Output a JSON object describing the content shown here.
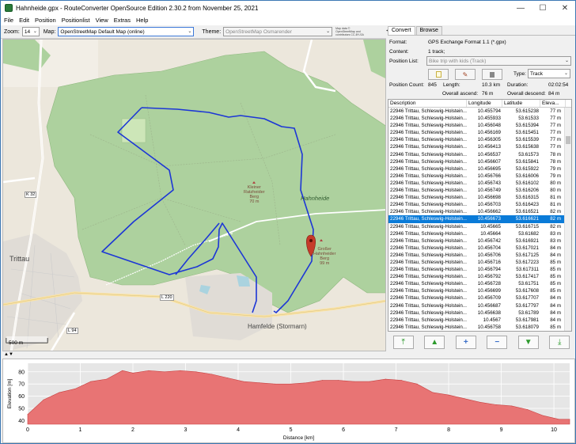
{
  "window": {
    "title": "Hahnheide.gpx - RouteConverter OpenSource Edition 2.30.2 from November 25, 2021",
    "minimize": "—",
    "maximize": "☐",
    "close": "✕"
  },
  "menu": [
    "File",
    "Edit",
    "Position",
    "Positionlist",
    "View",
    "Extras",
    "Help"
  ],
  "toolbar": {
    "zoom_label": "Zoom:",
    "zoom_value": "14",
    "map_label": "Map:",
    "map_value": "OpenStreetMap Default Map (online)",
    "theme_label": "Theme:",
    "theme_value": "OpenStreetMap Osmarender",
    "attribution": "Map data © OpenStreetMap and contributors CC-BY-SA"
  },
  "map": {
    "labels": {
      "hahnheide": "Hahnheide",
      "kleiner": "Kleiner",
      "kleiner2": "Ratzheider",
      "kleiner3": "Berg",
      "kleiner4": "70 m",
      "grosser": "Großer",
      "grosser2": "Hahnheider",
      "grosser3": "Berg",
      "grosser4": "99 m",
      "trittau": "Trittau",
      "hamfelde": "Hamfelde (Stormarn)",
      "k32": "K 32",
      "l94": "L 94",
      "l220": "L 220",
      "scale": "500 m"
    }
  },
  "right_panel": {
    "tabs": [
      "Convert",
      "Browse"
    ],
    "format_label": "Format:",
    "format_value": "GPS Exchange Format 1.1 (*.gpx)",
    "content_label": "Content:",
    "content_value": "1 track;",
    "poslist_label": "Position List:",
    "poslist_value": "Bike trip with kids (Track)",
    "type_label": "Type:",
    "type_value": "Track",
    "poscount_label": "Position Count:",
    "poscount_value": "845",
    "length_label": "Length:",
    "length_value": "10.3 km",
    "duration_label": "Duration:",
    "duration_value": "02:02:54",
    "ascend_label": "Overall ascend:",
    "ascend_value": "76 m",
    "descend_label": "Overall descend:",
    "descend_value": "84 m"
  },
  "table": {
    "headers": [
      "Description",
      "Longitude",
      "Latitude",
      "Eleva..."
    ],
    "rows": [
      [
        "22946 Trittau, Schleswig-Holstein...",
        "10.455794",
        "53.615238",
        "77 m"
      ],
      [
        "22946 Trittau, Schleswig-Holstein...",
        "10.455933",
        "53.61533",
        "77 m"
      ],
      [
        "22946 Trittau, Schleswig-Holstein...",
        "10.456048",
        "53.615394",
        "77 m"
      ],
      [
        "22946 Trittau, Schleswig-Holstein...",
        "10.456169",
        "53.615451",
        "77 m"
      ],
      [
        "22946 Trittau, Schleswig-Holstein...",
        "10.456305",
        "53.615539",
        "77 m"
      ],
      [
        "22946 Trittau, Schleswig-Holstein...",
        "10.456413",
        "53.615638",
        "77 m"
      ],
      [
        "22946 Trittau, Schleswig-Holstein...",
        "10.456537",
        "53.61573",
        "78 m"
      ],
      [
        "22946 Trittau, Schleswig-Holstein...",
        "10.456607",
        "53.615841",
        "78 m"
      ],
      [
        "22946 Trittau, Schleswig-Holstein...",
        "10.456695",
        "53.615922",
        "79 m"
      ],
      [
        "22946 Trittau, Schleswig-Holstein...",
        "10.456766",
        "53.616006",
        "79 m"
      ],
      [
        "22946 Trittau, Schleswig-Holstein...",
        "10.456743",
        "53.616102",
        "80 m"
      ],
      [
        "22946 Trittau, Schleswig-Holstein...",
        "10.456749",
        "53.616206",
        "80 m"
      ],
      [
        "22946 Trittau, Schleswig-Holstein...",
        "10.456698",
        "53.616315",
        "81 m"
      ],
      [
        "22946 Trittau, Schleswig-Holstein...",
        "10.456703",
        "53.616423",
        "81 m"
      ],
      [
        "22946 Trittau, Schleswig-Holstein...",
        "10.456662",
        "53.616521",
        "82 m"
      ],
      [
        "22946 Trittau, Schleswig-Holstein...",
        "10.456673",
        "53.616621",
        "82 m"
      ],
      [
        "22946 Trittau, Schleswig-Holstein...",
        "10.45665",
        "53.616715",
        "82 m"
      ],
      [
        "22946 Trittau, Schleswig-Holstein...",
        "10.45664",
        "53.61682",
        "83 m"
      ],
      [
        "22946 Trittau, Schleswig-Holstein...",
        "10.456742",
        "53.616921",
        "83 m"
      ],
      [
        "22946 Trittau, Schleswig-Holstein...",
        "10.456704",
        "53.617021",
        "84 m"
      ],
      [
        "22946 Trittau, Schleswig-Holstein...",
        "10.456706",
        "53.617125",
        "84 m"
      ],
      [
        "22946 Trittau, Schleswig-Holstein...",
        "10.456716",
        "53.617223",
        "85 m"
      ],
      [
        "22946 Trittau, Schleswig-Holstein...",
        "10.456794",
        "53.617311",
        "85 m"
      ],
      [
        "22946 Trittau, Schleswig-Holstein...",
        "10.456792",
        "53.617417",
        "85 m"
      ],
      [
        "22946 Trittau, Schleswig-Holstein...",
        "10.456728",
        "53.61751",
        "85 m"
      ],
      [
        "22946 Trittau, Schleswig-Holstein...",
        "10.456699",
        "53.617608",
        "85 m"
      ],
      [
        "22946 Trittau, Schleswig-Holstein...",
        "10.456709",
        "53.617707",
        "84 m"
      ],
      [
        "22946 Trittau, Schleswig-Holstein...",
        "10.456687",
        "53.617797",
        "84 m"
      ],
      [
        "22946 Trittau, Schleswig-Holstein...",
        "10.456638",
        "53.61789",
        "84 m"
      ],
      [
        "22946 Trittau, Schleswig-Holstein...",
        "10.4567",
        "53.617981",
        "84 m"
      ],
      [
        "22946 Trittau, Schleswig-Holstein...",
        "10.456758",
        "53.618079",
        "85 m"
      ]
    ],
    "selected_index": 15
  },
  "chart_data": {
    "type": "area",
    "xlabel": "Distance [km]",
    "ylabel": "Elevation [m]",
    "xlim": [
      0,
      10.3
    ],
    "ylim": [
      37,
      87
    ],
    "xticks": [
      0,
      1,
      2,
      3,
      4,
      5,
      6,
      7,
      8,
      9,
      10
    ],
    "yticks": [
      40,
      50,
      60,
      70,
      80
    ],
    "x": [
      0,
      0.3,
      0.6,
      0.9,
      1.2,
      1.5,
      1.8,
      2.0,
      2.3,
      2.6,
      2.9,
      3.2,
      3.5,
      3.8,
      4.1,
      4.4,
      4.7,
      5.0,
      5.3,
      5.6,
      5.9,
      6.2,
      6.5,
      6.8,
      7.1,
      7.4,
      7.7,
      8.0,
      8.3,
      8.6,
      8.9,
      9.2,
      9.5,
      9.8,
      10.1,
      10.3
    ],
    "values": [
      45,
      57,
      63,
      66,
      72,
      74,
      81,
      79,
      81,
      80,
      81,
      80,
      78,
      75,
      72,
      71,
      70,
      70,
      71,
      73,
      73,
      72,
      72,
      74,
      73,
      70,
      63,
      61,
      58,
      55,
      53,
      52,
      49,
      44,
      41,
      41
    ],
    "fill_color": "#e87474",
    "line_color": "#c84040"
  }
}
